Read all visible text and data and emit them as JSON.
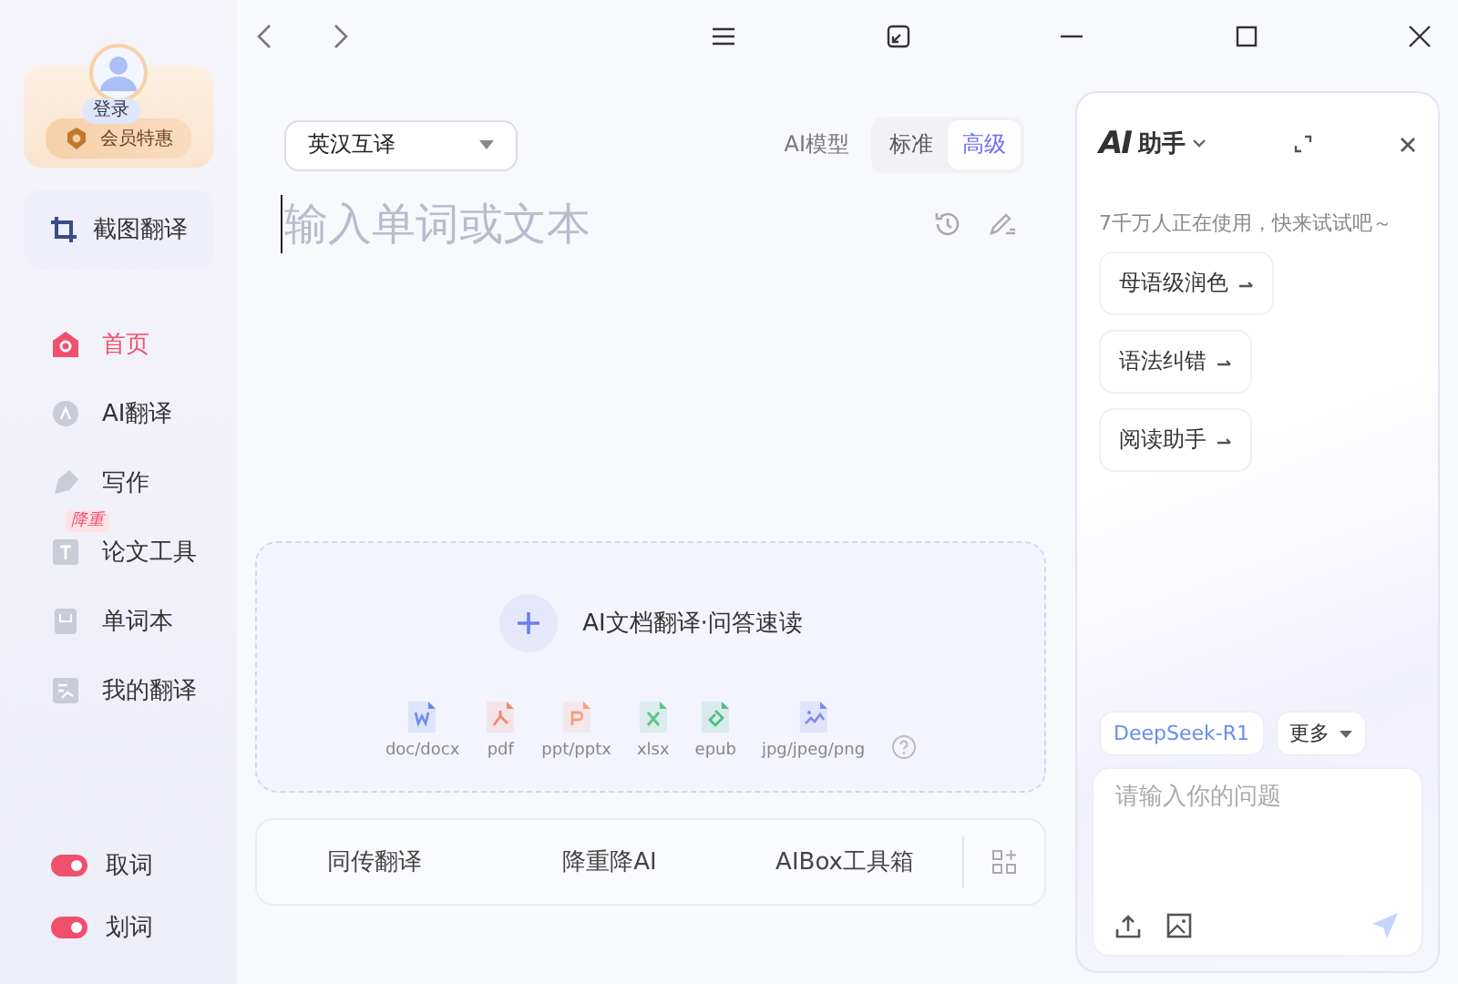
{
  "user": {
    "login": "登录",
    "vip": "会员特惠"
  },
  "screenshot_button": "截图翻译",
  "nav": [
    {
      "label": "首页",
      "selected": true
    },
    {
      "label": "AI翻译",
      "selected": false
    },
    {
      "label": "写作",
      "selected": false
    },
    {
      "label": "论文工具",
      "selected": false,
      "badge": "降重"
    },
    {
      "label": "单词本",
      "selected": false
    },
    {
      "label": "我的翻译",
      "selected": false
    }
  ],
  "toggles": [
    {
      "label": "取词",
      "on": true
    },
    {
      "label": "划词",
      "on": true
    }
  ],
  "language_select": "英汉互译",
  "model": {
    "label": "AI模型",
    "options": [
      {
        "label": "标准",
        "selected": false
      },
      {
        "label": "高级",
        "selected": true
      }
    ]
  },
  "input": {
    "placeholder": "输入单词或文本"
  },
  "upload": {
    "title": "AI文档翻译·问答速读",
    "formats": [
      {
        "label": "doc/docx",
        "kind": "word",
        "color": "#6b8cf0"
      },
      {
        "label": "pdf",
        "kind": "pdf",
        "color": "#f28a6b"
      },
      {
        "label": "ppt/pptx",
        "kind": "ppt",
        "color": "#f5a07a"
      },
      {
        "label": "xlsx",
        "kind": "xlsx",
        "color": "#5cc48a"
      },
      {
        "label": "epub",
        "kind": "epub",
        "color": "#4fbf85"
      },
      {
        "label": "jpg/jpeg/png",
        "kind": "image",
        "color": "#7a8cf0"
      }
    ]
  },
  "tools": [
    "同传翻译",
    "降重降AI",
    "AIBox工具箱"
  ],
  "assistant": {
    "logo": "AI",
    "title": "助手",
    "subtitle": "7千万人正在使用，快来试试吧～",
    "suggestions": [
      "母语级润色",
      "语法纠错",
      "阅读助手"
    ],
    "model": "DeepSeek-R1",
    "more": "更多",
    "placeholder": "请输入你的问题"
  }
}
